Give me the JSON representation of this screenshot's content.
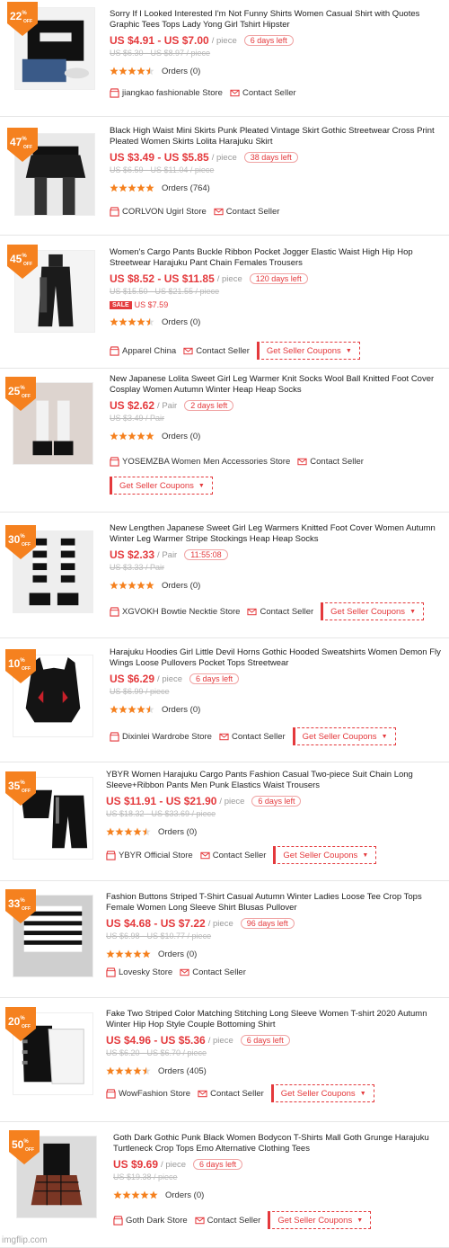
{
  "colors": {
    "accent": "#e4393c",
    "badge": "#f5811f",
    "star": "#f5811f"
  },
  "items": [
    {
      "discount": "22",
      "off": "OFF",
      "title": "Sorry If I Looked Interested I'm Not Funny Shirts Women Casual Shirt with Quotes Graphic Tees Tops Lady Yong Girl Tshirt Hipster",
      "price": "US $4.91 - US $7.00",
      "unit": "/ piece",
      "timer": "6 days left",
      "old": "US $6.30 - US $8.97 / piece",
      "rating": 4.5,
      "orders": "Orders (0)",
      "store": "jiangkao fashionable Store",
      "contact": "Contact Seller"
    },
    {
      "discount": "47",
      "off": "OFF",
      "title": "Black High Waist Mini Skirts Punk Pleated Vintage Skirt Gothic Streetwear Cross Print Pleated Women Skirts Lolita Harajuku Skirt",
      "price": "US $3.49 - US $5.85",
      "unit": "/ piece",
      "timer": "38 days left",
      "old": "US $6.59 - US $11.04 / piece",
      "rating": 5,
      "orders": "Orders (764)",
      "store": "CORLVON Ugirl Store",
      "contact": "Contact Seller"
    },
    {
      "discount": "45",
      "off": "OFF",
      "title": "Women's Cargo Pants Buckle Ribbon Pocket Jogger Elastic Waist High Hip Hop Streetwear Harajuku Pant Chain Females Trousers",
      "price": "US $8.52 - US $11.85",
      "unit": "/ piece",
      "timer": "120 days left",
      "old": "US $15.50 - US $21.55 / piece",
      "sale_tag": "SALE",
      "sale_price": "US $7.59",
      "rating": 4.5,
      "orders": "Orders (0)",
      "store": "Apparel China",
      "contact": "Contact Seller",
      "coupon": "Get Seller Coupons"
    },
    {
      "discount": "25",
      "off": "OFF",
      "title": "New Japanese Lolita Sweet Girl Leg Warmer Knit Socks Wool Ball Knitted Foot Cover Cosplay Women Autumn Winter Heap Heap Socks",
      "price": "US $2.62",
      "unit": "/ Pair",
      "timer": "2 days left",
      "old": "US $3.49 / Pair",
      "rating": 5,
      "orders": "Orders (0)",
      "store": "YOSEMZBA Women Men Accessories Store",
      "contact": "Contact Seller",
      "coupon": "Get Seller Coupons"
    },
    {
      "discount": "30",
      "off": "OFF",
      "title": "New Lengthen Japanese Sweet Girl Leg Warmers Knitted Foot Cover Women Autumn Winter Leg Warmer Stripe Stockings Heap Heap Socks",
      "price": "US $2.33",
      "unit": "/ Pair",
      "timer": "11:55:08",
      "old": "US $3.33 / Pair",
      "rating": 5,
      "orders": "Orders (0)",
      "store": "XGVOKH Bowtie Necktie Store",
      "contact": "Contact Seller",
      "coupon": "Get Seller Coupons"
    },
    {
      "discount": "10",
      "off": "OFF",
      "title": "Harajuku Hoodies Girl Little Devil Horns Gothic Hooded Sweatshirts Women Demon Fly Wings Loose Pullovers Pocket Tops Streetwear",
      "price": "US $6.29",
      "unit": "/ piece",
      "timer": "6 days left",
      "old": "US $6.99 / piece",
      "rating": 4.5,
      "orders": "Orders (0)",
      "store": "Dixinlei Wardrobe Store",
      "contact": "Contact Seller",
      "coupon": "Get Seller Coupons"
    },
    {
      "discount": "35",
      "off": "OFF",
      "title": "YBYR Women Harajuku Cargo Pants Fashion Casual Two-piece Suit Chain Long Sleeve+Ribbon Pants Men Punk Elastics Waist Trousers",
      "price": "US $11.91 - US $21.90",
      "unit": "/ piece",
      "timer": "6 days left",
      "old": "US $18.32 - US $33.69 / piece",
      "rating": 4.5,
      "orders": "Orders (0)",
      "store": "YBYR Official Store",
      "contact": "Contact Seller",
      "coupon": "Get Seller Coupons"
    },
    {
      "discount": "33",
      "off": "OFF",
      "title": "Fashion Buttons Striped T-Shirt Casual Autumn Winter Ladies Loose Tee Crop Tops Female Women Long Sleeve Shirt Blusas Pullover",
      "price": "US $4.68 - US $7.22",
      "unit": "/ piece",
      "timer": "96 days left",
      "old": "US $6.98 - US $10.77 / piece",
      "rating": 5,
      "orders": "Orders (0)",
      "store": "Lovesky Store",
      "contact": "Contact Seller"
    },
    {
      "discount": "20",
      "off": "OFF",
      "title": "Fake Two Striped Color Matching Stitching Long Sleeve Women T-shirt 2020 Autumn Winter Hip Hop Style Couple Bottoming Shirt",
      "price": "US $4.96 - US $5.36",
      "unit": "/ piece",
      "timer": "6 days left",
      "old": "US $6.20 - US $6.70 / piece",
      "rating": 4.5,
      "orders": "Orders (405)",
      "store": "WowFashion Store",
      "contact": "Contact Seller",
      "coupon": "Get Seller Coupons"
    },
    {
      "discount": "50",
      "off": "OFF",
      "title": "Goth Dark Gothic Punk Black Women Bodycon T-Shirts Mall Goth Grunge Harajuku Turtleneck Crop Tops Emo Alternative Clothing Tees",
      "price": "US $9.69",
      "unit": "/ piece",
      "timer": "6 days left",
      "old": "US $19.38 / piece",
      "rating": 5,
      "orders": "Orders (0)",
      "store": "Goth Dark Store",
      "contact": "Contact Seller",
      "coupon": "Get Seller Coupons"
    }
  ],
  "watermark": "imgflip.com"
}
